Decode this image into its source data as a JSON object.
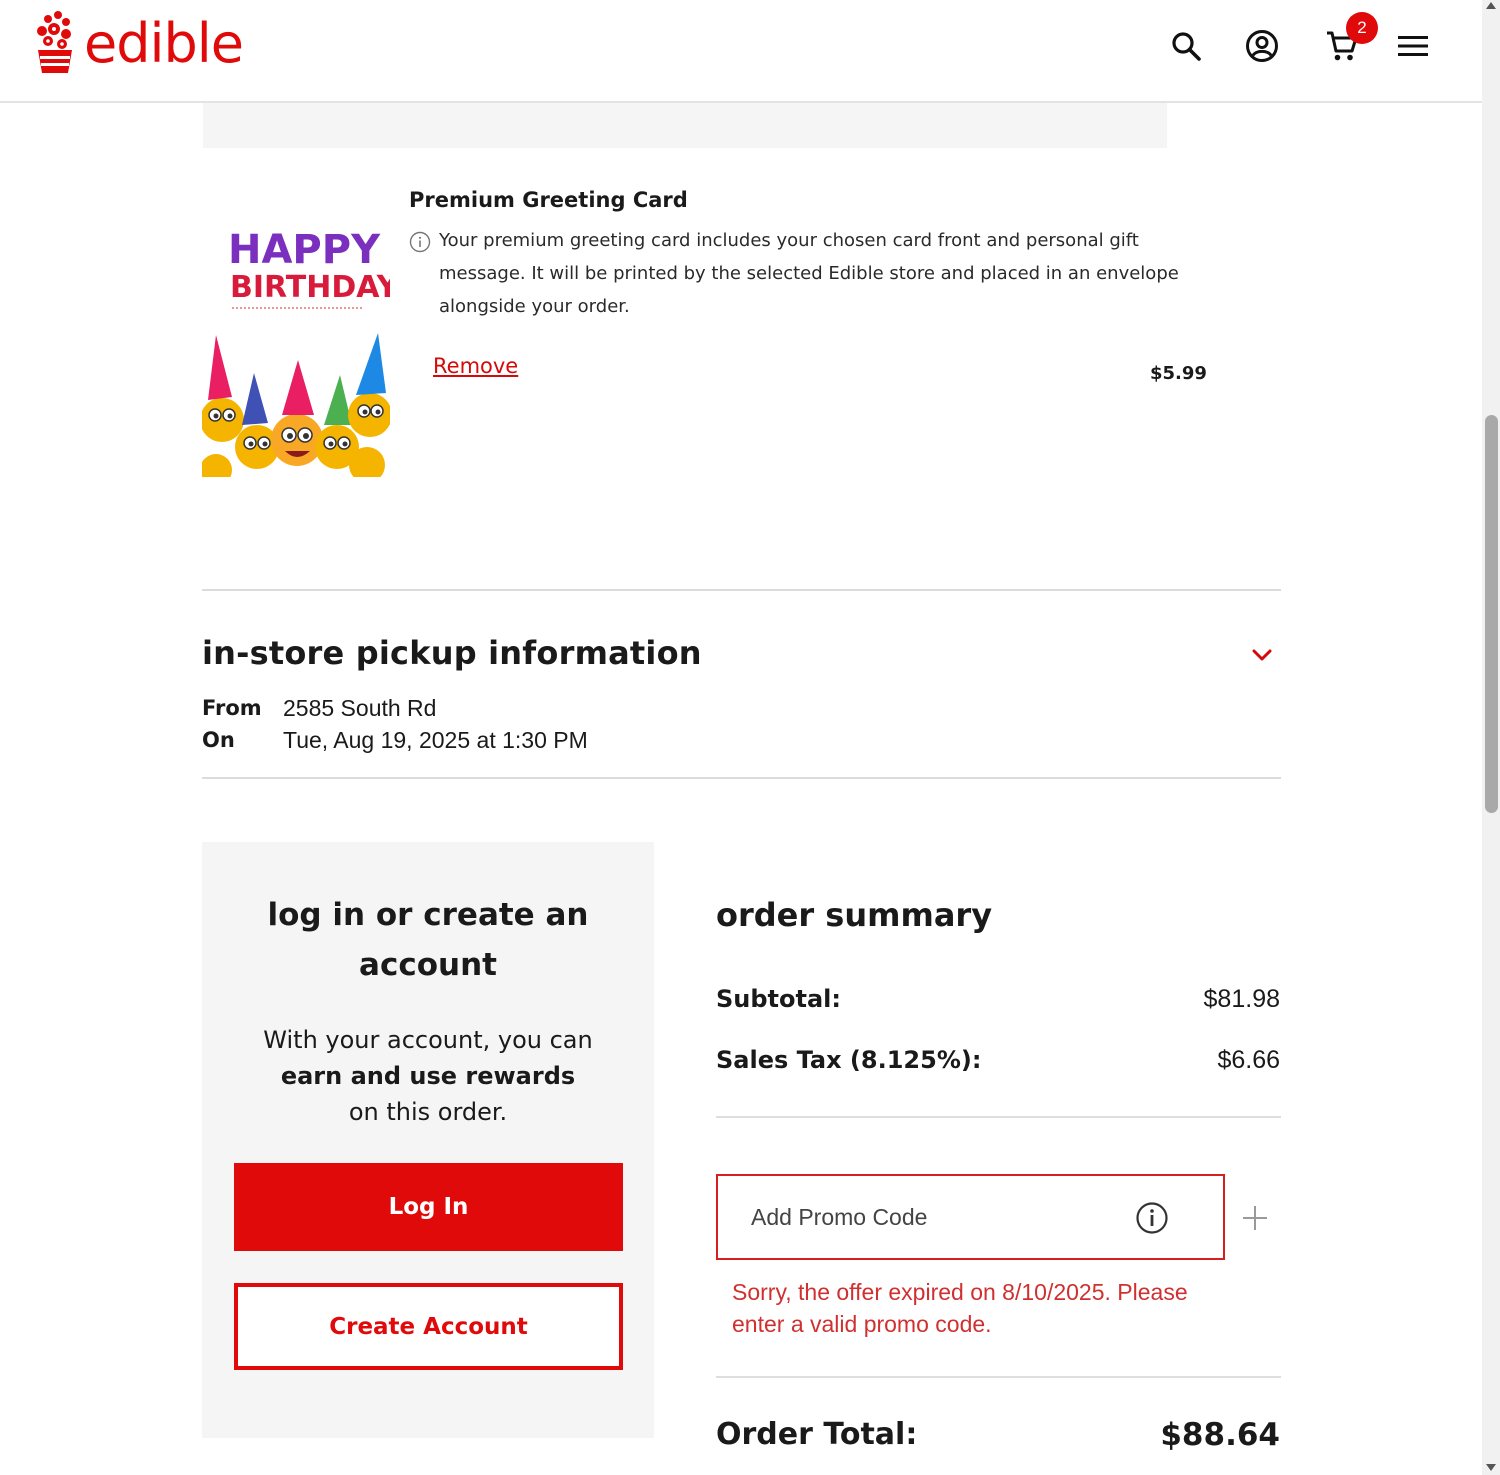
{
  "header": {
    "logo_text": "edible",
    "cart_count": "2",
    "brand_color": "#e10a0a"
  },
  "greeting_card": {
    "image_top_text": "HAPPY",
    "image_bottom_text": "BIRTHDAY",
    "title": "Premium Greeting Card",
    "description": "Your premium greeting card includes your chosen card front and personal gift message. It will be printed by the selected Edible store and placed in an envelope alongside your order.",
    "remove_label": "Remove",
    "price": "$5.99"
  },
  "pickup": {
    "title": "in-store pickup information",
    "from_label": "From",
    "from_value": "2585 South Rd",
    "on_label": "On",
    "on_value": "Tue, Aug 19, 2025 at 1:30 PM"
  },
  "account": {
    "title": "log in or create an account",
    "text_before": "With your account, you can",
    "text_bold": "earn and use rewards",
    "text_after": "on this order.",
    "login_label": "Log In",
    "create_label": "Create Account"
  },
  "summary": {
    "title": "order summary",
    "subtotal_label": "Subtotal:",
    "subtotal_value": "$81.98",
    "tax_label": "Sales Tax (8.125%):",
    "tax_value": "$6.66",
    "promo_placeholder": "Add Promo Code",
    "promo_error": "Sorry, the offer expired on 8/10/2025. Please enter a valid promo code.",
    "total_label": "Order Total:",
    "total_value": "$88.64"
  }
}
